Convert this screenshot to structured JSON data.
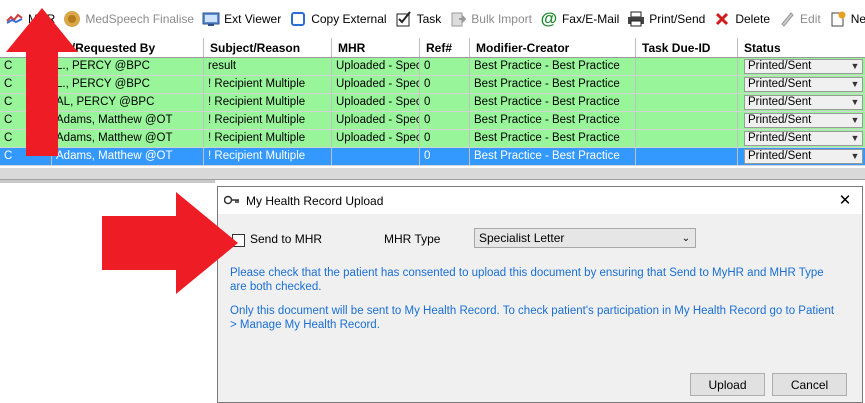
{
  "toolbar": {
    "items": [
      {
        "label": "MHR",
        "icon": "mhr-icon",
        "disabled": false
      },
      {
        "label": "MedSpeech Finalise",
        "icon": "medspeech-icon",
        "disabled": true
      },
      {
        "label": "Ext Viewer",
        "icon": "ext-viewer-icon",
        "disabled": false
      },
      {
        "label": "Copy External",
        "icon": "copy-icon",
        "disabled": false
      },
      {
        "label": "Task",
        "icon": "task-icon",
        "disabled": false
      },
      {
        "label": "Bulk Import",
        "icon": "bulk-import-icon",
        "disabled": true
      },
      {
        "label": "Fax/E-Mail",
        "icon": "fax-email-icon",
        "disabled": false
      },
      {
        "label": "Print/Send",
        "icon": "printer-icon",
        "disabled": false
      },
      {
        "label": "Delete",
        "icon": "delete-icon",
        "disabled": false
      },
      {
        "label": "Edit",
        "icon": "edit-icon",
        "disabled": true
      },
      {
        "label": "New",
        "icon": "new-icon",
        "disabled": false
      }
    ]
  },
  "grid": {
    "headers": [
      "",
      "To/Requested By",
      "Subject/Reason",
      "MHR",
      "Ref#",
      "Modifier-Creator",
      "Task Due-ID",
      "Status"
    ],
    "rows": [
      {
        "c1": "C",
        "to": "L., PERCY @BPC",
        "subject": "result",
        "mhr": "Uploaded - Spec",
        "ref": "0",
        "modifier": "Best Practice - Best Practice",
        "task": "",
        "status": "Printed/Sent",
        "selected": false
      },
      {
        "c1": "C",
        "to": "L., PERCY @BPC",
        "subject": "! Recipient Multiple",
        "mhr": "Uploaded - Spec",
        "ref": "0",
        "modifier": "Best Practice - Best Practice",
        "task": "",
        "status": "Printed/Sent",
        "selected": false
      },
      {
        "c1": "C",
        "to": "AL, PERCY @BPC",
        "subject": "! Recipient Multiple",
        "mhr": "Uploaded - Spec",
        "ref": "0",
        "modifier": "Best Practice - Best Practice",
        "task": "",
        "status": "Printed/Sent",
        "selected": false
      },
      {
        "c1": "C",
        "to": "Adams, Matthew @OT",
        "subject": "! Recipient Multiple",
        "mhr": "Uploaded - Spec",
        "ref": "0",
        "modifier": "Best Practice - Best Practice",
        "task": "",
        "status": "Printed/Sent",
        "selected": false
      },
      {
        "c1": "C",
        "to": "Adams, Matthew @OT",
        "subject": "! Recipient Multiple",
        "mhr": "Uploaded - Spec",
        "ref": "0",
        "modifier": "Best Practice - Best Practice",
        "task": "",
        "status": "Printed/Sent",
        "selected": false
      },
      {
        "c1": "C",
        "to": "Adams, Matthew @OT",
        "subject": "! Recipient Multiple",
        "mhr": "",
        "ref": "0",
        "modifier": "Best Practice - Best Practice",
        "task": "",
        "status": "Printed/Sent",
        "selected": true
      }
    ]
  },
  "dialog": {
    "title": "My Health Record Upload",
    "send_label": "Send to MHR",
    "type_label": "MHR Type",
    "type_value": "Specialist Letter",
    "message1": "Please check that the patient has consented to upload this document by ensuring that Send to MyHR and MHR Type are both checked.",
    "message2": "Only this document will be sent to My Health Record. To check patient's participation in My Health Record go to Patient > Manage My Health Record.",
    "upload_label": "Upload",
    "cancel_label": "Cancel"
  },
  "colors": {
    "row_green": "#98f59a",
    "row_selected": "#3399ff",
    "message_blue": "#1a6fd1",
    "arrow_red": "#ee1c25"
  }
}
